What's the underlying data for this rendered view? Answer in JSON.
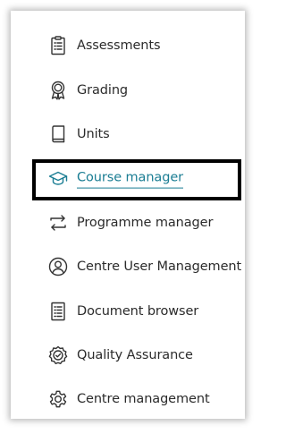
{
  "menu": {
    "items": [
      {
        "label": "Assessments",
        "icon": "clipboard-list-icon"
      },
      {
        "label": "Grading",
        "icon": "award-ribbon-icon"
      },
      {
        "label": "Units",
        "icon": "book-icon"
      },
      {
        "label": "Course manager",
        "icon": "graduation-cap-icon",
        "active": true
      },
      {
        "label": "Programme manager",
        "icon": "swap-arrows-icon"
      },
      {
        "label": "Centre User Management",
        "icon": "user-circle-icon"
      },
      {
        "label": "Document browser",
        "icon": "document-list-icon"
      },
      {
        "label": "Quality Assurance",
        "icon": "badge-check-icon"
      },
      {
        "label": "Centre management",
        "icon": "gear-icon"
      }
    ]
  },
  "colors": {
    "text": "#2b2b2b",
    "active": "#1a7d93",
    "icon": "#333333",
    "focus_ring": "#000000"
  }
}
